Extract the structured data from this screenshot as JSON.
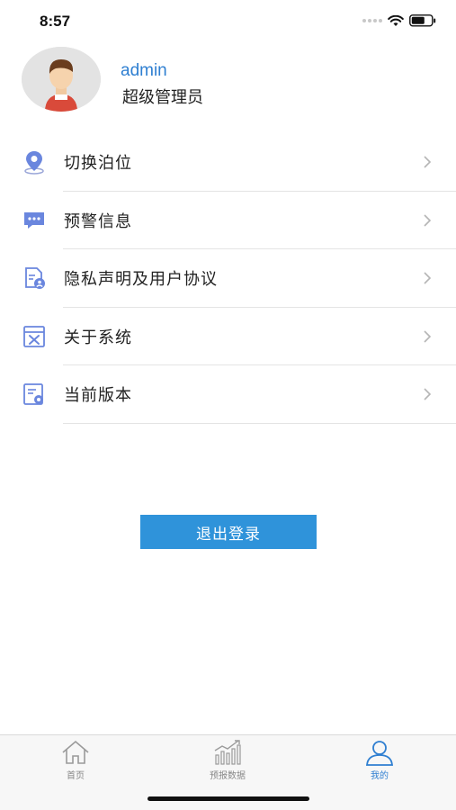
{
  "status_bar": {
    "time": "8:57"
  },
  "profile": {
    "username": "admin",
    "role": "超级管理员"
  },
  "menu": {
    "items": [
      {
        "label": "切换泊位",
        "icon": "location-pin-icon"
      },
      {
        "label": "预警信息",
        "icon": "message-icon"
      },
      {
        "label": "隐私声明及用户协议",
        "icon": "document-user-icon"
      },
      {
        "label": "关于系统",
        "icon": "settings-window-icon"
      },
      {
        "label": "当前版本",
        "icon": "version-icon"
      }
    ]
  },
  "logout_label": "退出登录",
  "tab_bar": {
    "tabs": [
      {
        "label": "首页",
        "icon": "home-icon",
        "active": false
      },
      {
        "label": "预报数据",
        "icon": "chart-icon",
        "active": false
      },
      {
        "label": "我的",
        "icon": "user-icon",
        "active": true
      }
    ]
  },
  "colors": {
    "accent": "#2f93da",
    "link": "#2f7fd1",
    "divider": "#e4e4e4"
  }
}
